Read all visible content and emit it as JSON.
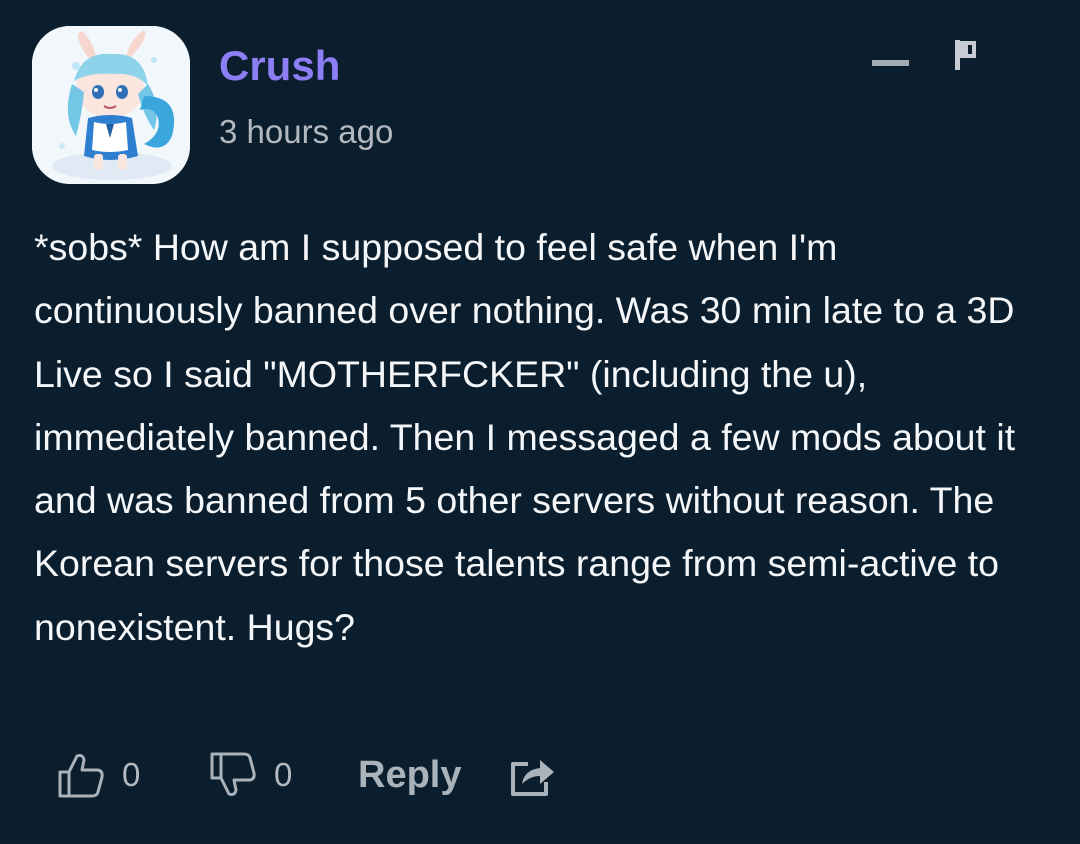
{
  "comment": {
    "author": "Crush",
    "timestamp": "3 hours ago",
    "text": "*sobs* How am I supposed to feel safe when I'm continuously banned over nothing. Was 30 min late to a 3D Live so I said \"MOTHERFCKER\" (including the u), immediately banned. Then I messaged a few mods about it and was banned from 5 other servers without reason. The Korean servers for those talents range from semi-active to nonexistent. Hugs?",
    "likes": "0",
    "dislikes": "0",
    "reply_label": "Reply"
  },
  "icons": {
    "collapse": "minus-icon",
    "flag": "flag-icon",
    "like": "thumbs-up-icon",
    "dislike": "thumbs-down-icon",
    "share": "share-icon"
  },
  "colors": {
    "background": "#0b1e2e",
    "username": "#8d7ef5",
    "muted": "#b2b9c0",
    "body_text": "#f4f6f8"
  }
}
